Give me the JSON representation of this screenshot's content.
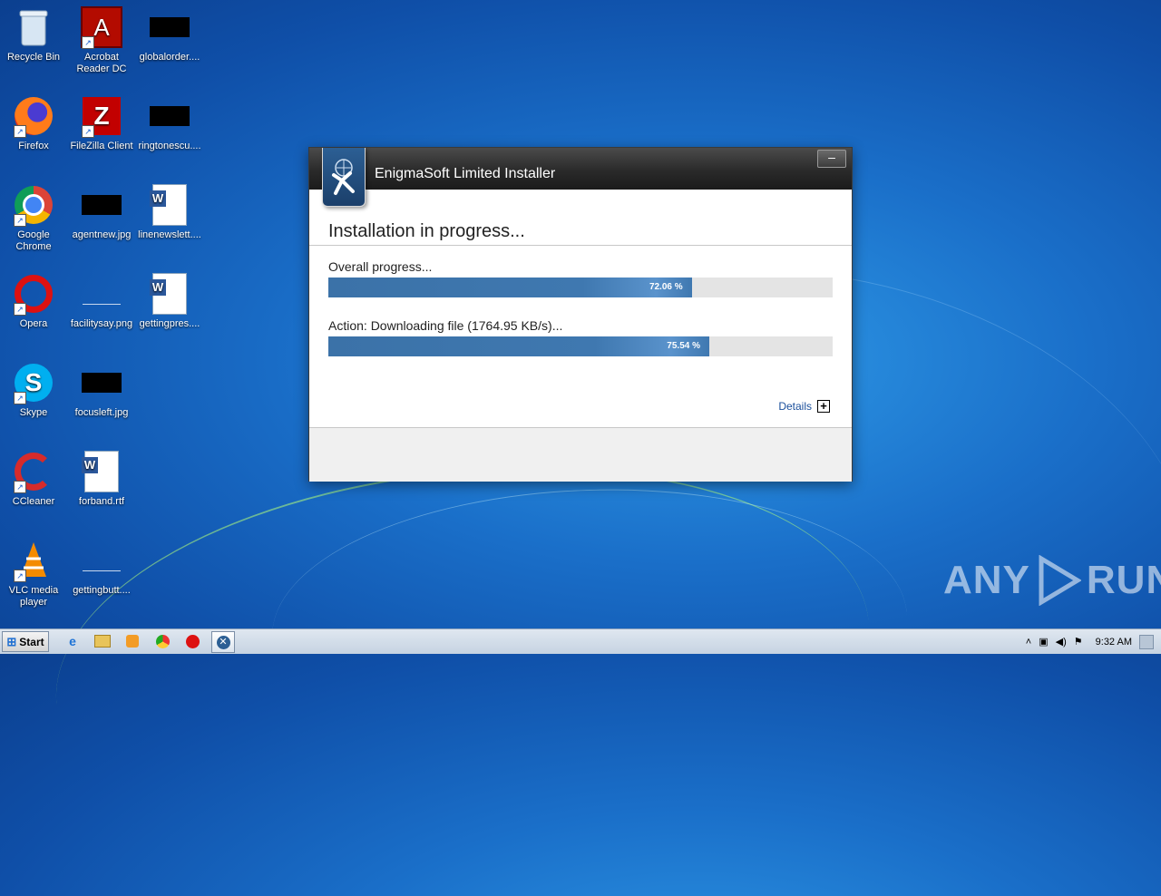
{
  "desktop": {
    "icons": [
      {
        "label": "Recycle Bin",
        "icon": "recycle-bin-icon"
      },
      {
        "label": "Acrobat Reader DC",
        "icon": "acrobat-reader-icon"
      },
      {
        "label": "globalorder....",
        "icon": "redacted-file-icon"
      },
      {
        "label": "Firefox",
        "icon": "firefox-icon"
      },
      {
        "label": "FileZilla Client",
        "icon": "filezilla-icon"
      },
      {
        "label": "ringtonescu....",
        "icon": "redacted-file-icon"
      },
      {
        "label": "Google Chrome",
        "icon": "chrome-icon"
      },
      {
        "label": "agentnew.jpg",
        "icon": "redacted-file-icon"
      },
      {
        "label": "linenewslett....",
        "icon": "word-document-icon"
      },
      {
        "label": "Opera",
        "icon": "opera-icon"
      },
      {
        "label": "facilitysay.png",
        "icon": "image-file-icon"
      },
      {
        "label": "gettingpres....",
        "icon": "word-document-icon"
      },
      {
        "label": "Skype",
        "icon": "skype-icon"
      },
      {
        "label": "focusleft.jpg",
        "icon": "redacted-file-icon"
      },
      {
        "label": "CCleaner",
        "icon": "ccleaner-icon"
      },
      {
        "label": "forband.rtf",
        "icon": "word-document-icon"
      },
      {
        "label": "VLC media player",
        "icon": "vlc-icon"
      },
      {
        "label": "gettingbutt....",
        "icon": "image-file-icon"
      }
    ]
  },
  "installer": {
    "title": "EnigmaSoft Limited Installer",
    "heading": "Installation in progress...",
    "overall_label": "Overall progress...",
    "overall_percent_text": "72.06 %",
    "overall_fraction": 0.7206,
    "action_label": "Action: Downloading file (1764.95 KB/s)...",
    "action_percent_text": "75.54 %",
    "action_fraction": 0.7554,
    "details_label": "Details",
    "minimize_label": "‒"
  },
  "watermark": {
    "text_left": "ANY",
    "text_right": "RUN"
  },
  "taskbar": {
    "start_label": "Start",
    "pinned": [
      "internet-explorer-icon",
      "file-explorer-icon",
      "media-player-icon",
      "chrome-icon",
      "opera-icon",
      "enigmasoft-installer-icon"
    ],
    "clock": "9:32 AM"
  }
}
